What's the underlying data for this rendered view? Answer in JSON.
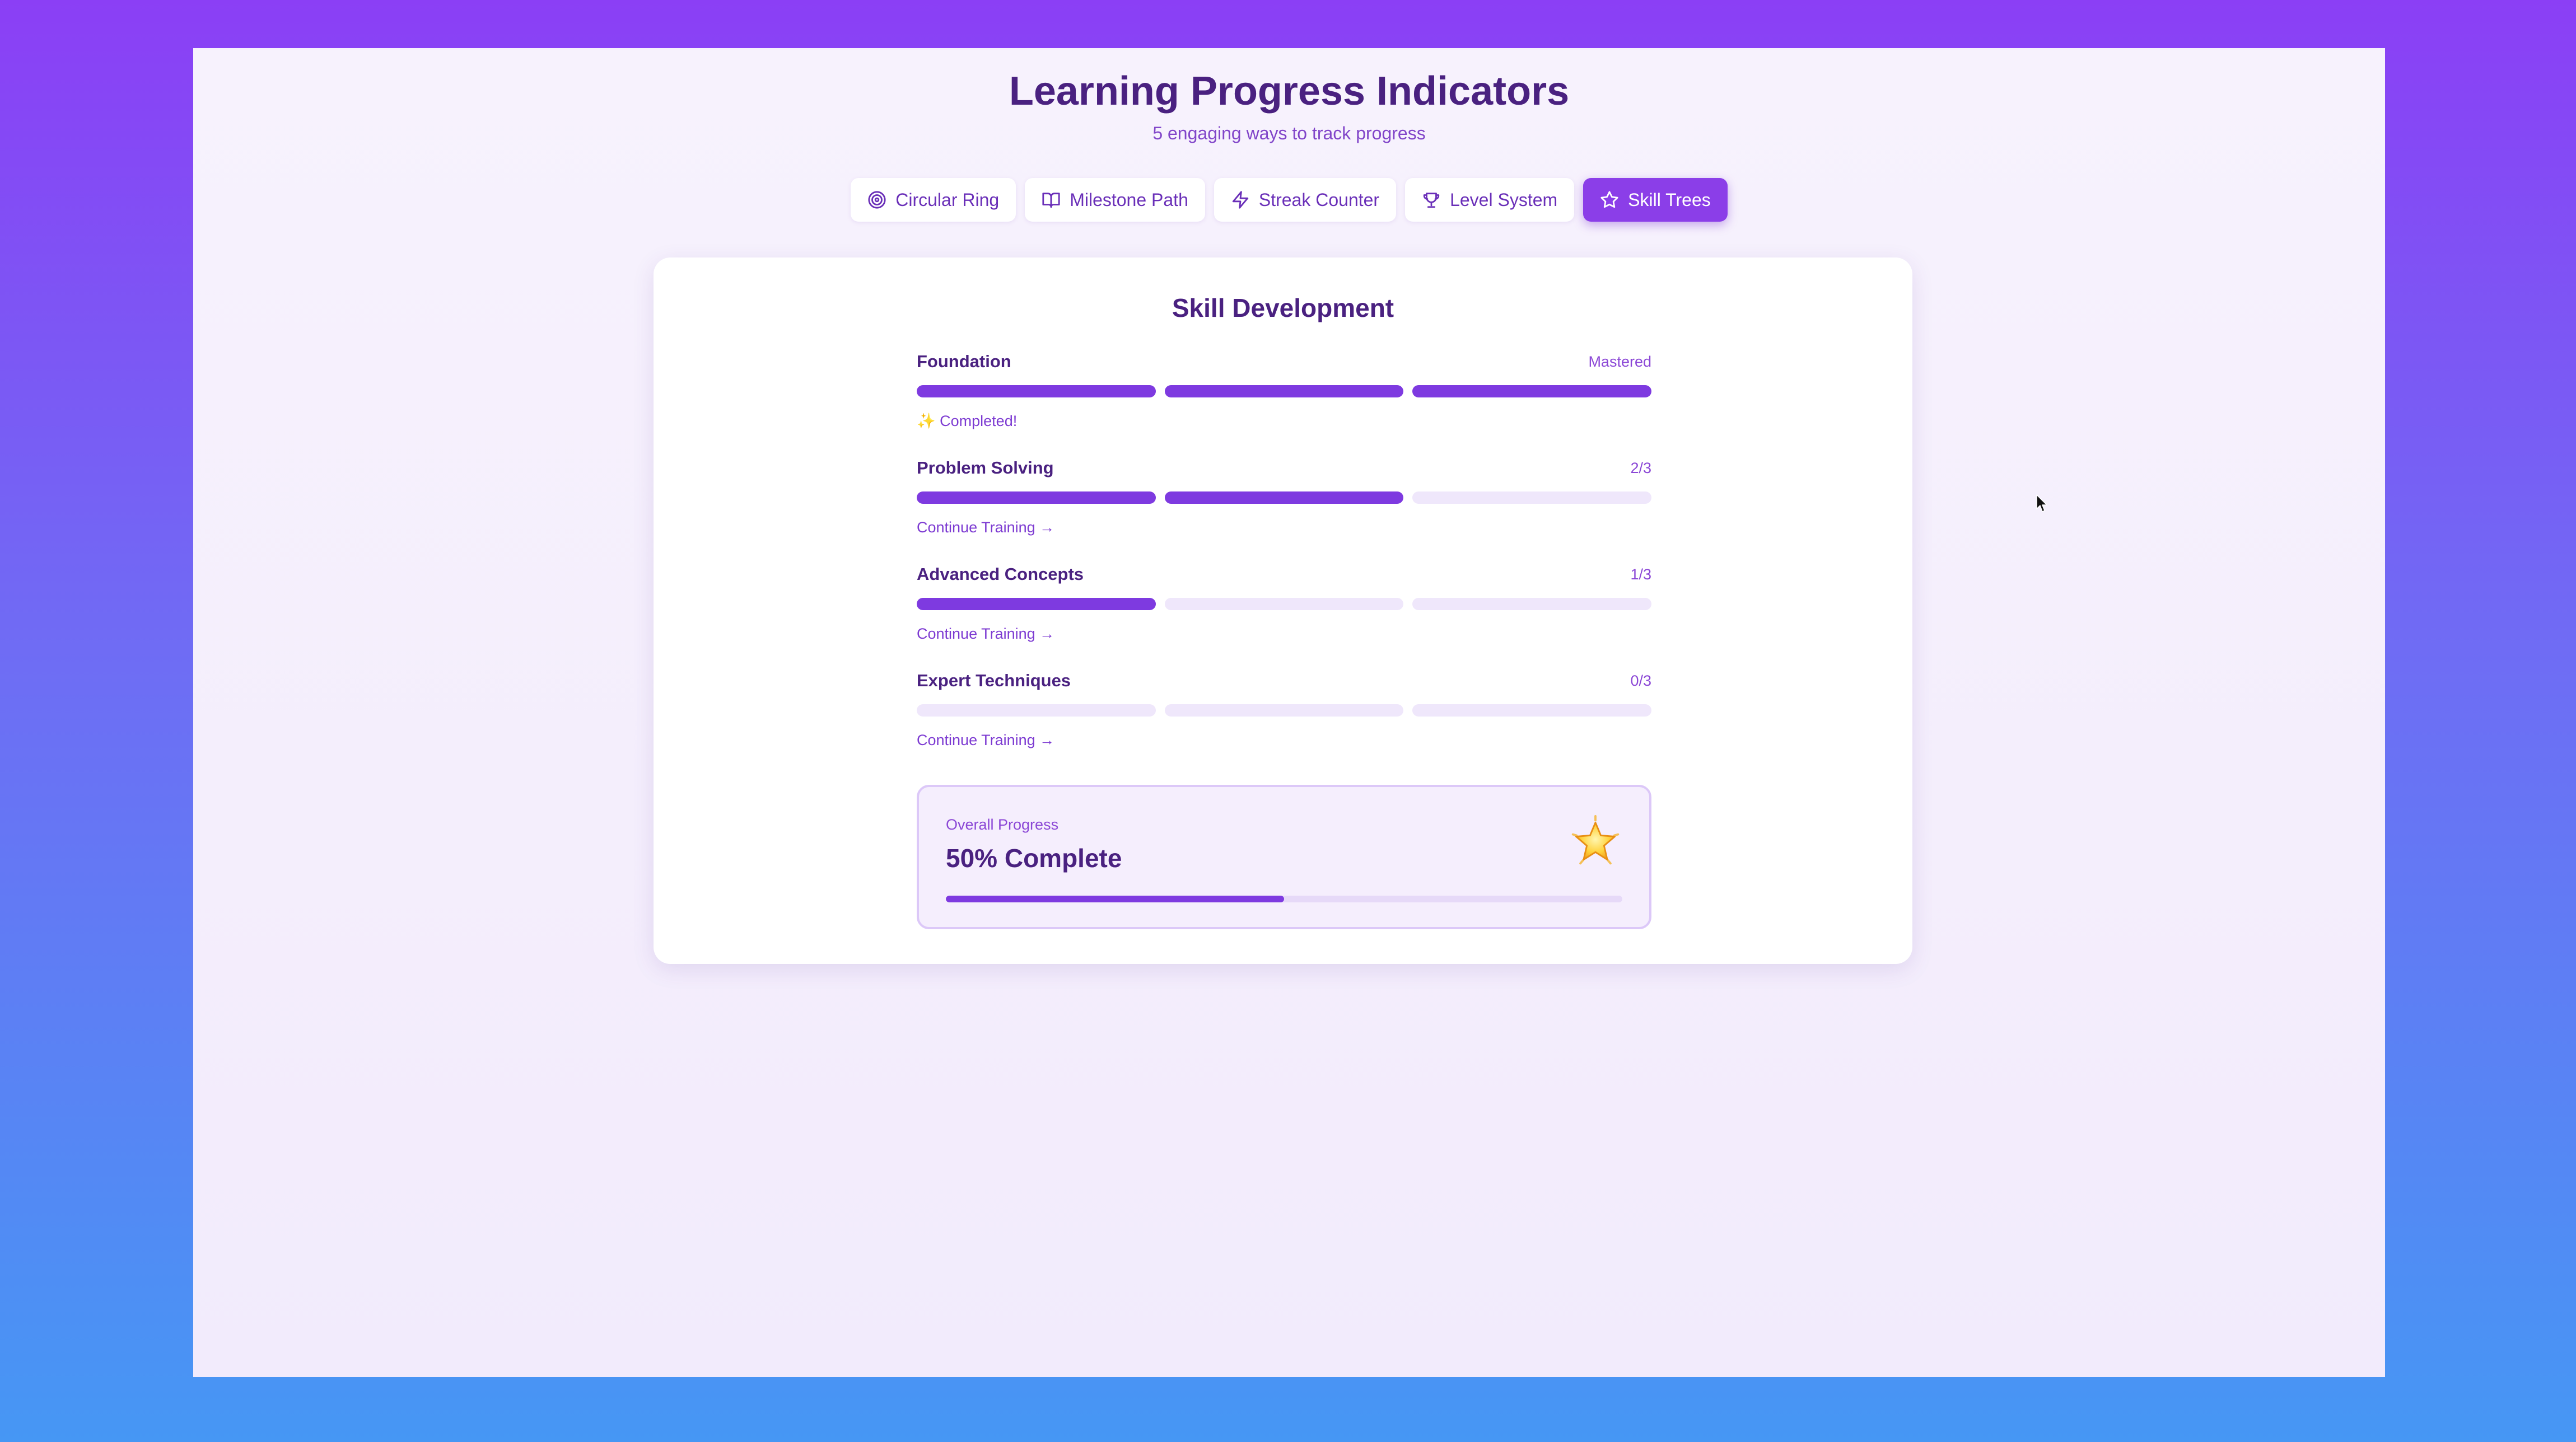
{
  "header": {
    "title": "Learning Progress Indicators",
    "subtitle": "5 engaging ways to track progress"
  },
  "tabs": [
    {
      "label": "Circular Ring",
      "icon": "target-icon",
      "active": false
    },
    {
      "label": "Milestone Path",
      "icon": "book-open-icon",
      "active": false
    },
    {
      "label": "Streak Counter",
      "icon": "lightning-icon",
      "active": false
    },
    {
      "label": "Level System",
      "icon": "trophy-icon",
      "active": false
    },
    {
      "label": "Skill Trees",
      "icon": "star-icon",
      "active": true
    }
  ],
  "card": {
    "title": "Skill Development",
    "skills": [
      {
        "name": "Foundation",
        "status": "Mastered",
        "completed": 3,
        "total": 3,
        "footer_icon": "✨",
        "footer": "Completed!"
      },
      {
        "name": "Problem Solving",
        "status": "2/3",
        "completed": 2,
        "total": 3,
        "footer": "Continue Training →"
      },
      {
        "name": "Advanced Concepts",
        "status": "1/3",
        "completed": 1,
        "total": 3,
        "footer": "Continue Training →"
      },
      {
        "name": "Expert Techniques",
        "status": "0/3",
        "completed": 0,
        "total": 3,
        "footer": "Continue Training →"
      }
    ],
    "overall": {
      "label": "Overall Progress",
      "value_text": "50% Complete",
      "percent": 50,
      "icon": "glowing-star-icon"
    }
  },
  "colors": {
    "accent": "#8b3ee8",
    "segment_filled": "#7e3ae0",
    "segment_empty": "#efe7fb",
    "title": "#4a2180"
  }
}
